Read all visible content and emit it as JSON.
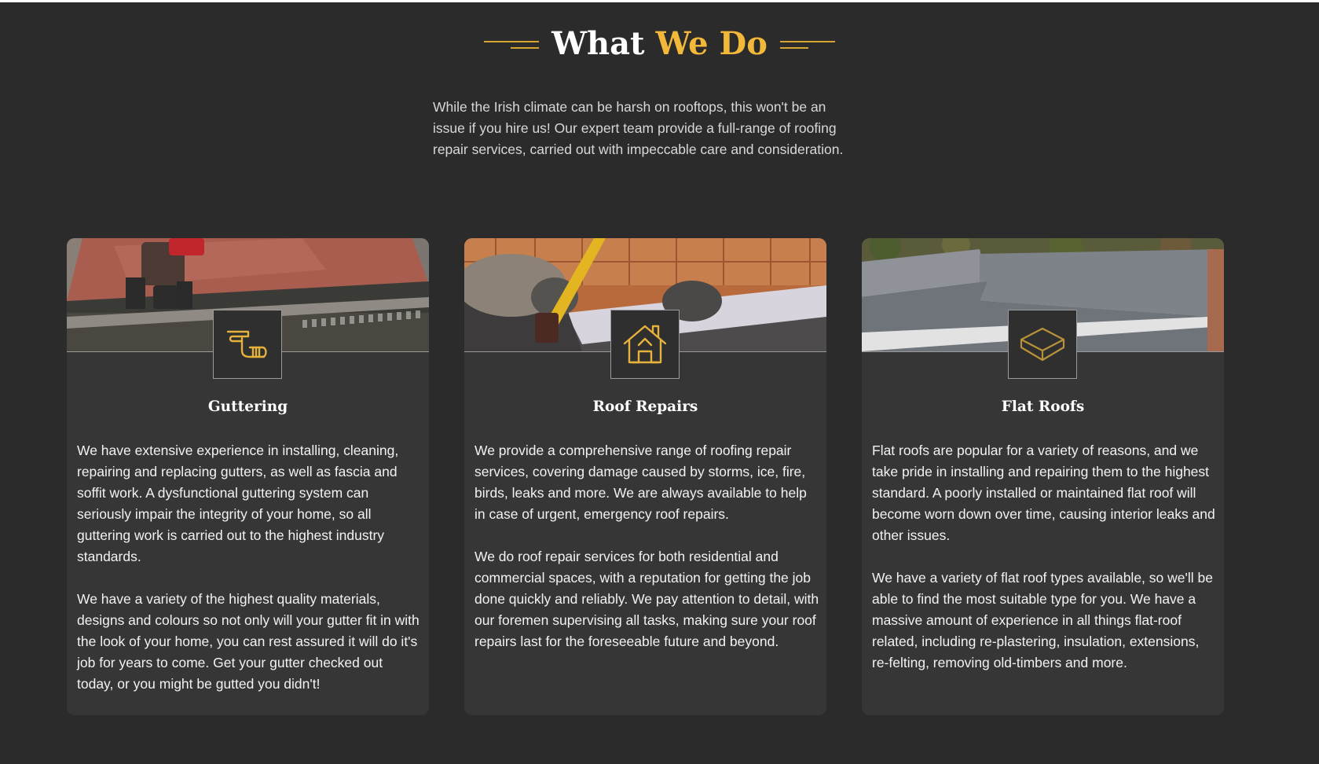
{
  "section": {
    "title_main": "What",
    "title_accent": "We Do",
    "intro": "While the Irish climate can be harsh on rooftops, this won't be an issue if you hire us! Our expert team provide a full-range of roofing repair services, carried out with impeccable care and consideration."
  },
  "colors": {
    "background": "#2b2b2b",
    "card_background": "#363636",
    "accent": "#f2b83a",
    "text": "#f2f2f2"
  },
  "cards": [
    {
      "title": "Guttering",
      "icon": "gutter-icon",
      "image": "guttering-photo",
      "paragraphs": [
        "We have extensive experience in installing, cleaning, repairing and replacing gutters, as well as fascia and soffit work. A dysfunctional guttering system can seriously impair the integrity of your home, so all guttering work is carried out to the highest industry standards.",
        "We have a variety of the highest quality materials, designs and colours so not only will your gutter fit in with the look of your home, you can rest assured it will do it's job for years to come. Get your gutter checked out today, or you might be gutted you didn't!"
      ]
    },
    {
      "title": "Roof Repairs",
      "icon": "house-roof-icon",
      "image": "roof-repair-photo",
      "paragraphs": [
        "We provide a comprehensive range of roofing repair services, covering damage caused by storms, ice, fire, birds, leaks and more. We are always available to help in case of urgent, emergency roof repairs.",
        "We do roof repair services for both residential and commercial spaces, with a reputation for getting the job done quickly and reliably. We pay attention to detail, with our foremen supervising all tasks, making sure your roof repairs last for the foreseeable future and beyond."
      ]
    },
    {
      "title": "Flat Roofs",
      "icon": "flat-roof-icon",
      "image": "flat-roof-photo",
      "paragraphs": [
        "Flat roofs are popular for a variety of reasons, and we take pride in installing and repairing them to the highest standard. A poorly installed or maintained flat roof will become worn down over time, causing interior leaks and other issues.",
        "We have a variety of flat roof types available, so we'll be able to find the most suitable type for you. We have a massive amount of experience in all things flat-roof related, including re-plastering, insulation, extensions, re-felting, removing old-timbers and more."
      ]
    }
  ]
}
